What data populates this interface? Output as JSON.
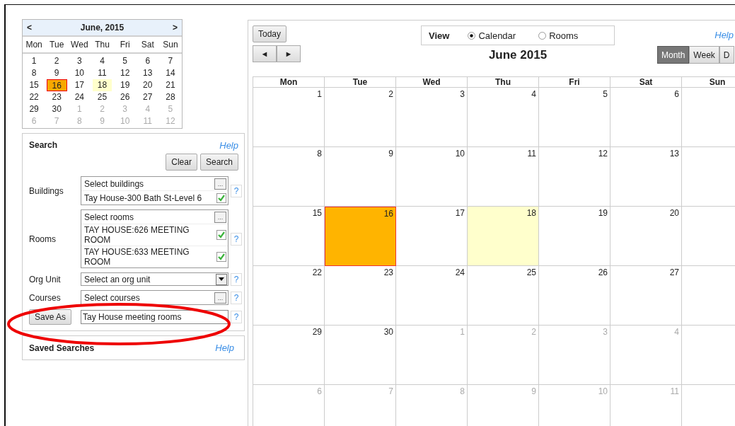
{
  "mini_calendar": {
    "prev": "<",
    "title": "June, 2015",
    "next": ">",
    "weekdays": [
      "Mon",
      "Tue",
      "Wed",
      "Thu",
      "Fri",
      "Sat",
      "Sun"
    ],
    "days": [
      {
        "day": "1",
        "other_month": false,
        "selected": false,
        "today": false
      },
      {
        "day": "2",
        "other_month": false,
        "selected": false,
        "today": false
      },
      {
        "day": "3",
        "other_month": false,
        "selected": false,
        "today": false
      },
      {
        "day": "4",
        "other_month": false,
        "selected": false,
        "today": false
      },
      {
        "day": "5",
        "other_month": false,
        "selected": false,
        "today": false
      },
      {
        "day": "6",
        "other_month": false,
        "selected": false,
        "today": false
      },
      {
        "day": "7",
        "other_month": false,
        "selected": false,
        "today": false
      },
      {
        "day": "8",
        "other_month": false,
        "selected": false,
        "today": false
      },
      {
        "day": "9",
        "other_month": false,
        "selected": false,
        "today": false
      },
      {
        "day": "10",
        "other_month": false,
        "selected": false,
        "today": false
      },
      {
        "day": "11",
        "other_month": false,
        "selected": false,
        "today": false
      },
      {
        "day": "12",
        "other_month": false,
        "selected": false,
        "today": false
      },
      {
        "day": "13",
        "other_month": false,
        "selected": false,
        "today": false
      },
      {
        "day": "14",
        "other_month": false,
        "selected": false,
        "today": false
      },
      {
        "day": "15",
        "other_month": false,
        "selected": false,
        "today": false
      },
      {
        "day": "16",
        "other_month": false,
        "selected": true,
        "today": false
      },
      {
        "day": "17",
        "other_month": false,
        "selected": false,
        "today": false
      },
      {
        "day": "18",
        "other_month": false,
        "selected": false,
        "today": true
      },
      {
        "day": "19",
        "other_month": false,
        "selected": false,
        "today": false
      },
      {
        "day": "20",
        "other_month": false,
        "selected": false,
        "today": false
      },
      {
        "day": "21",
        "other_month": false,
        "selected": false,
        "today": false
      },
      {
        "day": "22",
        "other_month": false,
        "selected": false,
        "today": false
      },
      {
        "day": "23",
        "other_month": false,
        "selected": false,
        "today": false
      },
      {
        "day": "24",
        "other_month": false,
        "selected": false,
        "today": false
      },
      {
        "day": "25",
        "other_month": false,
        "selected": false,
        "today": false
      },
      {
        "day": "26",
        "other_month": false,
        "selected": false,
        "today": false
      },
      {
        "day": "27",
        "other_month": false,
        "selected": false,
        "today": false
      },
      {
        "day": "28",
        "other_month": false,
        "selected": false,
        "today": false
      },
      {
        "day": "29",
        "other_month": false,
        "selected": false,
        "today": false
      },
      {
        "day": "30",
        "other_month": false,
        "selected": false,
        "today": false
      },
      {
        "day": "1",
        "other_month": true,
        "selected": false,
        "today": false
      },
      {
        "day": "2",
        "other_month": true,
        "selected": false,
        "today": false
      },
      {
        "day": "3",
        "other_month": true,
        "selected": false,
        "today": false
      },
      {
        "day": "4",
        "other_month": true,
        "selected": false,
        "today": false
      },
      {
        "day": "5",
        "other_month": true,
        "selected": false,
        "today": false
      },
      {
        "day": "6",
        "other_month": true,
        "selected": false,
        "today": false
      },
      {
        "day": "7",
        "other_month": true,
        "selected": false,
        "today": false
      },
      {
        "day": "8",
        "other_month": true,
        "selected": false,
        "today": false
      },
      {
        "day": "9",
        "other_month": true,
        "selected": false,
        "today": false
      },
      {
        "day": "10",
        "other_month": true,
        "selected": false,
        "today": false
      },
      {
        "day": "11",
        "other_month": true,
        "selected": false,
        "today": false
      },
      {
        "day": "12",
        "other_month": true,
        "selected": false,
        "today": false
      }
    ]
  },
  "search": {
    "title": "Search",
    "help": "Help",
    "buttons": [
      "Clear",
      "Search"
    ],
    "fields": [
      {
        "kind": "multi",
        "label": "Buildings",
        "prompt": "Select buildings",
        "picker": "...",
        "help": "?",
        "items": [
          {
            "text": "Tay House-300 Bath St-Level 6",
            "checked": true
          }
        ]
      },
      {
        "kind": "multi",
        "label": "Rooms",
        "prompt": "Select rooms",
        "picker": "...",
        "help": "?",
        "items": [
          {
            "text": "TAY HOUSE:626 MEETING ROOM",
            "checked": true
          },
          {
            "text": "TAY HOUSE:633 MEETING ROOM",
            "checked": true
          }
        ]
      },
      {
        "kind": "dropdown",
        "label": "Org Unit",
        "prompt": "Select an org unit",
        "help": "?"
      },
      {
        "kind": "multi",
        "label": "Courses",
        "prompt": "Select courses",
        "picker": "...",
        "help": "?"
      }
    ],
    "save_as": {
      "button": "Save As",
      "value": "Tay House meeting rooms",
      "help": "?"
    }
  },
  "saved_searches": {
    "title": "Saved Searches",
    "help": "Help"
  },
  "calendar": {
    "today_button": "Today",
    "nav": [
      "◄",
      "►"
    ],
    "view": {
      "label": "View",
      "options": [
        {
          "label": "Calendar",
          "selected": true
        },
        {
          "label": "Rooms",
          "selected": false
        }
      ]
    },
    "help": "Help",
    "title": "June 2015",
    "modes": [
      {
        "label": "Month",
        "selected": true
      },
      {
        "label": "Week",
        "selected": false
      },
      {
        "label": "D",
        "selected": false
      }
    ],
    "weekdays": [
      "Mon",
      "Tue",
      "Wed",
      "Thu",
      "Fri",
      "Sat",
      "Sun"
    ],
    "weeks": [
      [
        {
          "day": "1",
          "other_month": false,
          "selected": false,
          "today": false
        },
        {
          "day": "2",
          "other_month": false,
          "selected": false,
          "today": false
        },
        {
          "day": "3",
          "other_month": false,
          "selected": false,
          "today": false
        },
        {
          "day": "4",
          "other_month": false,
          "selected": false,
          "today": false
        },
        {
          "day": "5",
          "other_month": false,
          "selected": false,
          "today": false
        },
        {
          "day": "6",
          "other_month": false,
          "selected": false,
          "today": false
        }
      ],
      [
        {
          "day": "8",
          "other_month": false,
          "selected": false,
          "today": false
        },
        {
          "day": "9",
          "other_month": false,
          "selected": false,
          "today": false
        },
        {
          "day": "10",
          "other_month": false,
          "selected": false,
          "today": false
        },
        {
          "day": "11",
          "other_month": false,
          "selected": false,
          "today": false
        },
        {
          "day": "12",
          "other_month": false,
          "selected": false,
          "today": false
        },
        {
          "day": "13",
          "other_month": false,
          "selected": false,
          "today": false
        }
      ],
      [
        {
          "day": "15",
          "other_month": false,
          "selected": false,
          "today": false
        },
        {
          "day": "16",
          "other_month": false,
          "selected": true,
          "today": false
        },
        {
          "day": "17",
          "other_month": false,
          "selected": false,
          "today": false
        },
        {
          "day": "18",
          "other_month": false,
          "selected": false,
          "today": true
        },
        {
          "day": "19",
          "other_month": false,
          "selected": false,
          "today": false
        },
        {
          "day": "20",
          "other_month": false,
          "selected": false,
          "today": false
        }
      ],
      [
        {
          "day": "22",
          "other_month": false,
          "selected": false,
          "today": false
        },
        {
          "day": "23",
          "other_month": false,
          "selected": false,
          "today": false
        },
        {
          "day": "24",
          "other_month": false,
          "selected": false,
          "today": false
        },
        {
          "day": "25",
          "other_month": false,
          "selected": false,
          "today": false
        },
        {
          "day": "26",
          "other_month": false,
          "selected": false,
          "today": false
        },
        {
          "day": "27",
          "other_month": false,
          "selected": false,
          "today": false
        }
      ],
      [
        {
          "day": "29",
          "other_month": false,
          "selected": false,
          "today": false
        },
        {
          "day": "30",
          "other_month": false,
          "selected": false,
          "today": false
        },
        {
          "day": "1",
          "other_month": true,
          "selected": false,
          "today": false
        },
        {
          "day": "2",
          "other_month": true,
          "selected": false,
          "today": false
        },
        {
          "day": "3",
          "other_month": true,
          "selected": false,
          "today": false
        },
        {
          "day": "4",
          "other_month": true,
          "selected": false,
          "today": false
        }
      ],
      [
        {
          "day": "6",
          "other_month": true,
          "selected": false,
          "today": false
        },
        {
          "day": "7",
          "other_month": true,
          "selected": false,
          "today": false
        },
        {
          "day": "8",
          "other_month": true,
          "selected": false,
          "today": false
        },
        {
          "day": "9",
          "other_month": true,
          "selected": false,
          "today": false
        },
        {
          "day": "10",
          "other_month": true,
          "selected": false,
          "today": false
        },
        {
          "day": "11",
          "other_month": true,
          "selected": false,
          "today": false
        }
      ]
    ]
  }
}
